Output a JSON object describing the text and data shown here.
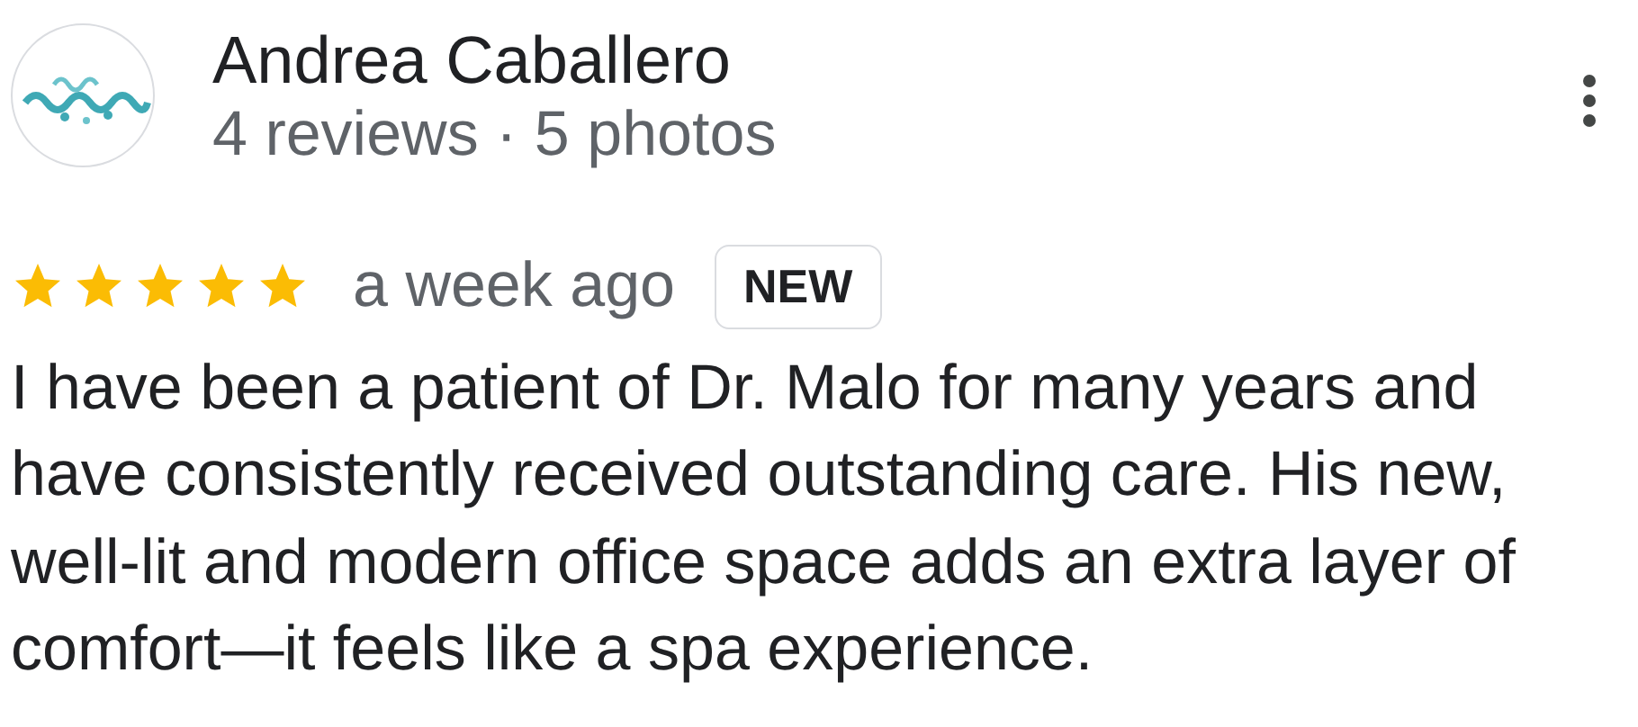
{
  "reviewer": {
    "name": "Andrea Caballero",
    "meta": "4 reviews · 5 photos"
  },
  "review": {
    "stars": 5,
    "time": "a week ago",
    "badge": "NEW",
    "text": "I have been a patient of Dr. Malo for many years and have consistently received outstanding care. His new, well-lit and modern office space adds an extra layer of comfort—it feels like a spa experience."
  }
}
